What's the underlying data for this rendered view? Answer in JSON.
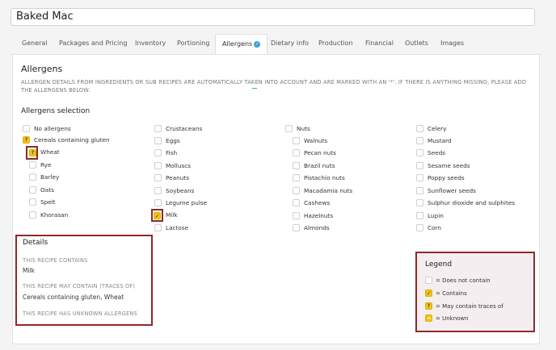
{
  "recipe_name": "Baked Mac",
  "tabs": [
    {
      "label": "General"
    },
    {
      "label": "Packages and Pricing"
    },
    {
      "label": "Inventory"
    },
    {
      "label": "Portioning"
    },
    {
      "label": "Allergens"
    },
    {
      "label": "Dietary info"
    },
    {
      "label": "Production"
    },
    {
      "label": "Financial"
    },
    {
      "label": "Outlets"
    },
    {
      "label": "Images"
    }
  ],
  "allergens": {
    "heading": "Allergens",
    "info": "ALLERGEN DETAILS FROM INGREDIENTS OR SUB RECIPES ARE AUTOMATICALLY TAKEN INTO ACCOUNT AND ARE MARKED WITH AN '*'. IF THERE IS ANYTHING MISSING, PLEASE ADD THE ALLERGENS BELOW.",
    "selection_heading": "Allergens selection",
    "col1": [
      {
        "label": "No allergens",
        "state": "none"
      },
      {
        "label": "Cereals containing gluten",
        "state": "traces"
      },
      {
        "label": "Wheat",
        "state": "traces"
      },
      {
        "label": "Rye",
        "state": "none"
      },
      {
        "label": "Barley",
        "state": "none"
      },
      {
        "label": "Oats",
        "state": "none"
      },
      {
        "label": "Spelt",
        "state": "none"
      },
      {
        "label": "Khorasan",
        "state": "none"
      }
    ],
    "col2": [
      {
        "label": "Crustaceans",
        "state": "none"
      },
      {
        "label": "Eggs",
        "state": "none"
      },
      {
        "label": "Fish",
        "state": "none"
      },
      {
        "label": "Molluscs",
        "state": "none"
      },
      {
        "label": "Peanuts",
        "state": "none"
      },
      {
        "label": "Soybeans",
        "state": "none"
      },
      {
        "label": "Legume pulse",
        "state": "none"
      },
      {
        "label": "Milk",
        "state": "contains"
      },
      {
        "label": "Lactose",
        "state": "none"
      }
    ],
    "col3": [
      {
        "label": "Nuts",
        "state": "none"
      },
      {
        "label": "Walnuts",
        "state": "none"
      },
      {
        "label": "Pecan nuts",
        "state": "none"
      },
      {
        "label": "Brazil nuts",
        "state": "none"
      },
      {
        "label": "Pistachio nuts",
        "state": "none"
      },
      {
        "label": "Macadamia nuts",
        "state": "none"
      },
      {
        "label": "Cashews",
        "state": "none"
      },
      {
        "label": "Hazelnuts",
        "state": "none"
      },
      {
        "label": "Almonds",
        "state": "none"
      }
    ],
    "col4": [
      {
        "label": "Celery",
        "state": "none"
      },
      {
        "label": "Mustard",
        "state": "none"
      },
      {
        "label": "Seeds",
        "state": "none"
      },
      {
        "label": "Sesame seeds",
        "state": "none"
      },
      {
        "label": "Poppy seeds",
        "state": "none"
      },
      {
        "label": "Sunflower seeds",
        "state": "none"
      },
      {
        "label": "Sulphur dioxide and sulphites",
        "state": "none"
      },
      {
        "label": "Lupin",
        "state": "none"
      },
      {
        "label": "Corn",
        "state": "none"
      }
    ]
  },
  "details": {
    "title": "Details",
    "contains_label": "THIS RECIPE CONTAINS",
    "contains_value": "Milk",
    "traces_label": "THIS RECIPE MAY CONTAIN (TRACES OF)",
    "traces_value": "Cereals containing gluten, Wheat",
    "unknown_label": "THIS RECIPE HAS UNKNOWN ALLERGENS"
  },
  "legend": {
    "title": "Legend",
    "items": [
      {
        "label": "= Does not contain",
        "state": "none"
      },
      {
        "label": "= Contains",
        "state": "contains"
      },
      {
        "label": "= May contain traces of",
        "state": "traces"
      },
      {
        "label": "= Unknown",
        "state": "unknown"
      }
    ]
  },
  "colors": {
    "highlight_border": "#8d2a2a",
    "accent": "#3aa0d8",
    "badge_yellow": "#f2c41b"
  }
}
